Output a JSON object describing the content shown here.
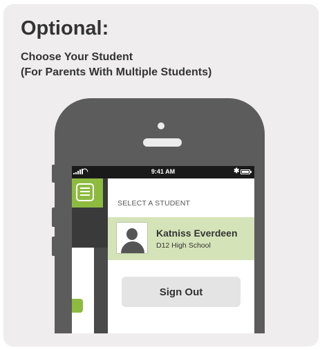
{
  "header": {
    "title": "Optional:",
    "subtitle_line1": "Choose Your Student",
    "subtitle_line2": "(For Parents With Multiple Students)"
  },
  "statusbar": {
    "time": "9:41 AM"
  },
  "app": {
    "menu_icon": "menu-icon",
    "section_label": "SELECT A STUDENT",
    "students": [
      {
        "name": "Katniss Everdeen",
        "school": "D12 High School",
        "selected": true
      }
    ],
    "signout_label": "Sign Out"
  },
  "colors": {
    "accent_green": "#8dbb3f",
    "selected_row": "#d5e4b8",
    "phone_body": "#5c5c5c",
    "card_bg": "#efedee"
  }
}
